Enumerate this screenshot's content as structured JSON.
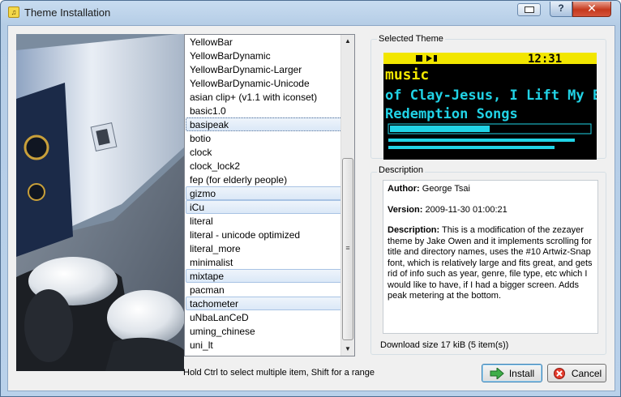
{
  "window": {
    "title": "Theme Installation",
    "help_label": "?",
    "close_label": "✕"
  },
  "theme_list": {
    "items": [
      {
        "label": "YellowBar",
        "selected": false
      },
      {
        "label": "YellowBarDynamic",
        "selected": false
      },
      {
        "label": "YellowBarDynamic-Larger",
        "selected": false
      },
      {
        "label": "YellowBarDynamic-Unicode",
        "selected": false
      },
      {
        "label": "asian clip+ (v1.1 with iconset)",
        "selected": false
      },
      {
        "label": "basic1.0",
        "selected": false
      },
      {
        "label": "basipeak",
        "selected": true,
        "focused": true
      },
      {
        "label": "botio",
        "selected": false
      },
      {
        "label": "clock",
        "selected": false
      },
      {
        "label": "clock_lock2",
        "selected": false
      },
      {
        "label": "fep (for elderly people)",
        "selected": false
      },
      {
        "label": "gizmo",
        "selected": true
      },
      {
        "label": "iCu",
        "selected": true
      },
      {
        "label": "literal",
        "selected": false
      },
      {
        "label": "literal - unicode optimized",
        "selected": false
      },
      {
        "label": "literal_more",
        "selected": false
      },
      {
        "label": "minimalist",
        "selected": false
      },
      {
        "label": "mixtape",
        "selected": true
      },
      {
        "label": "pacman",
        "selected": false
      },
      {
        "label": "tachometer",
        "selected": true
      },
      {
        "label": "uNbaLanCeD",
        "selected": false
      },
      {
        "label": "uming_chinese",
        "selected": false
      },
      {
        "label": "uni_lt",
        "selected": false
      }
    ]
  },
  "hint_text": "Hold Ctrl to select multiple item, Shift for a range",
  "selected_theme": {
    "legend": "Selected Theme",
    "preview": {
      "time": "12:31",
      "line1": "music",
      "line2": "of Clay-Jesus, I Lift My E",
      "line3": "Redemption Songs",
      "progress": 0.5
    }
  },
  "description": {
    "legend": "Description",
    "author_label": "Author:",
    "author": "George Tsai",
    "version_label": "Version:",
    "version": "2009-11-30 01:00:21",
    "description_label": "Description:",
    "text": "This is a modification of the zezayer theme by Jake Owen and it implements scrolling for title and directory names, uses the #10 Artwiz-Snap font, which is relatively large and fits great, and gets rid of info such as year, genre, file type, etc which I would like to have, if I had a bigger screen. Adds peak metering at the bottom."
  },
  "download": {
    "text": "Download size  17 kiB (5 item(s))"
  },
  "buttons": {
    "install": "Install",
    "cancel": "Cancel"
  },
  "colors": {
    "preview_yellow": "#f2e600",
    "preview_cyan": "#21d3e6"
  }
}
